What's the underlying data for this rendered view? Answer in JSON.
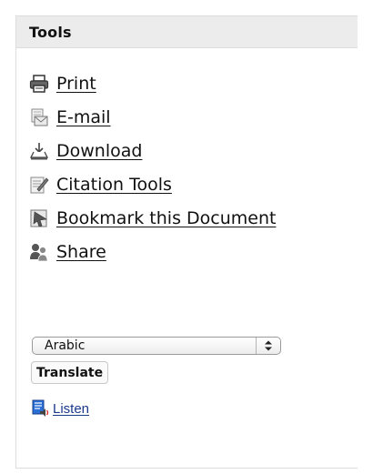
{
  "panel": {
    "title": "Tools"
  },
  "tools": [
    {
      "label": "Print",
      "icon": "printer-icon"
    },
    {
      "label": "E-mail",
      "icon": "email-icon"
    },
    {
      "label": "Download",
      "icon": "download-icon"
    },
    {
      "label": "Citation Tools",
      "icon": "citation-icon"
    },
    {
      "label": "Bookmark this Document",
      "icon": "bookmark-icon"
    },
    {
      "label": "Share",
      "icon": "share-icon"
    }
  ],
  "translate": {
    "language_selected": "Arabic",
    "button_label": "Translate"
  },
  "listen": {
    "label": "Listen",
    "icon": "speaker-icon"
  },
  "colors": {
    "header_bg": "#ececec",
    "border": "#dcdcdc",
    "listen_link": "#1a3a8a"
  }
}
